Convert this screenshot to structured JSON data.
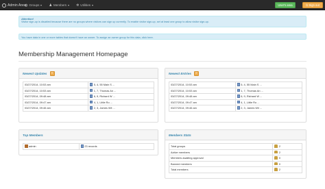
{
  "navbar": {
    "brand": "Admin Area",
    "menu": [
      {
        "label": "Groups",
        "icon": "globe-icon"
      },
      {
        "label": "Members",
        "icon": "user-icon"
      },
      {
        "label": "Utilities",
        "icon": "gear-icon"
      }
    ],
    "users_area_label": "User's area",
    "sign_out_label": "Sign out"
  },
  "alerts": {
    "signup_heading": "Attention!",
    "signup_text": "Visitor sign-up is disabled because there are no groups where visitors can sign up currently. To enable visitor sign-up, set at least one group to allow visitor sign-up.",
    "owner_text": "You have data in one or more tables that doesn't have an owner. To assign an owner group for this data, click here."
  },
  "page_title": "Membership Management Homepage",
  "newest_updates": {
    "title": "Newest Updates",
    "button": "»",
    "rows": [
      {
        "date": "03/27/2014, 10:53 am",
        "record": "5, 4, 55 Main S ..."
      },
      {
        "date": "03/27/2014, 10:53 am",
        "record": "1, 7, Thomas An ..."
      },
      {
        "date": "03/27/2014, 09:48 am",
        "record": "6, 9, Richard W ..."
      },
      {
        "date": "03/27/2014, 09:47 am",
        "record": "4, 1, Little Ro ..."
      },
      {
        "date": "03/27/2014, 09:46 am",
        "record": "2, 3, James Wil ..."
      }
    ]
  },
  "newest_entries": {
    "title": "Newest Entries",
    "button": "»",
    "rows": [
      {
        "date": "03/27/2014, 10:53 am",
        "record": "5, 4, 55 Main S ..."
      },
      {
        "date": "03/27/2014, 10:53 am",
        "record": "1, 7, Thomas An ..."
      },
      {
        "date": "03/27/2014, 09:48 am",
        "record": "6, 9, Richard W ..."
      },
      {
        "date": "03/27/2014, 09:47 am",
        "record": "4, 1, Little Ro ..."
      },
      {
        "date": "03/27/2014, 09:46 am",
        "record": "2, 3, James Wil ..."
      }
    ]
  },
  "top_members": {
    "title": "Top Members",
    "rows": [
      {
        "name": "admin",
        "records": "23 records"
      }
    ]
  },
  "members_stats": {
    "title": "Members Stats",
    "rows": [
      {
        "label": "Total groups",
        "value": "2"
      },
      {
        "label": "Active members",
        "value": "2"
      },
      {
        "label": "Members awaiting approval",
        "value": "0"
      },
      {
        "label": "Banned members",
        "value": "0"
      },
      {
        "label": "Total members",
        "value": "2"
      }
    ]
  }
}
